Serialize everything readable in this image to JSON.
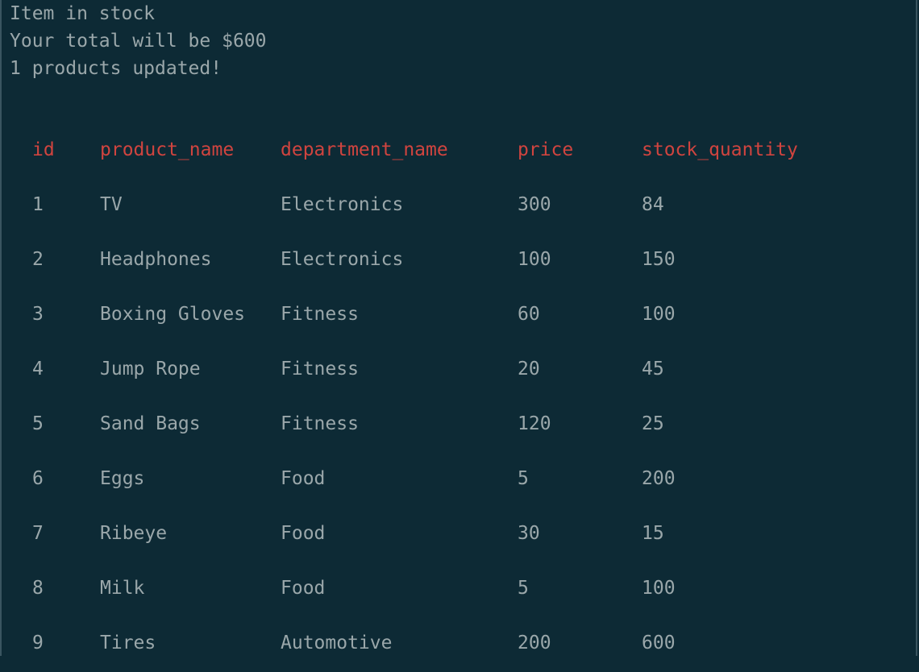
{
  "console": {
    "lines": [
      "Item in stock",
      "Your total will be $600",
      "1 products updated!"
    ]
  },
  "colors": {
    "background": "#0d2a35",
    "text": "#9aa7aa",
    "header": "#d0443f"
  },
  "table": {
    "headers": [
      "id",
      "product_name",
      "department_name",
      "price",
      "stock_quantity"
    ],
    "rows": [
      [
        "1",
        "TV",
        "Electronics",
        "300",
        "84"
      ],
      [
        "2",
        "Headphones",
        "Electronics",
        "100",
        "150"
      ],
      [
        "3",
        "Boxing Gloves",
        "Fitness",
        "60",
        "100"
      ],
      [
        "4",
        "Jump Rope",
        "Fitness",
        "20",
        "45"
      ],
      [
        "5",
        "Sand Bags",
        "Fitness",
        "120",
        "25"
      ],
      [
        "6",
        "Eggs",
        "Food",
        "5",
        "200"
      ],
      [
        "7",
        "Ribeye",
        "Food",
        "30",
        "15"
      ],
      [
        "8",
        "Milk",
        "Food",
        "5",
        "100"
      ],
      [
        "9",
        "Tires",
        "Automotive",
        "200",
        "600"
      ]
    ]
  }
}
